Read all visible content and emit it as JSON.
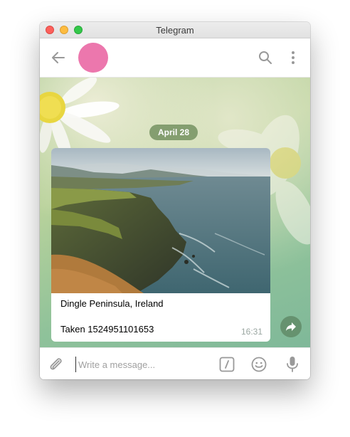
{
  "window": {
    "title": "Telegram"
  },
  "chat": {
    "date_label": "April 28",
    "message": {
      "caption_line1": "Dingle Peninsula, Ireland",
      "caption_line2": "Taken 1524951101653",
      "time": "16:31"
    }
  },
  "composer": {
    "placeholder": "Write a message..."
  },
  "colors": {
    "avatar": "#ec77ad",
    "date_pill": "#6c8a58",
    "forward_button": "#5c8462",
    "icon_gray": "#999999"
  },
  "icons": {
    "back": "arrow-left-icon",
    "search": "search-icon",
    "more": "more-vertical-icon",
    "forward": "forward-arrow-icon",
    "attach": "paperclip-icon",
    "commands": "slash-command-icon",
    "emoji": "smiley-icon",
    "voice": "microphone-icon"
  }
}
